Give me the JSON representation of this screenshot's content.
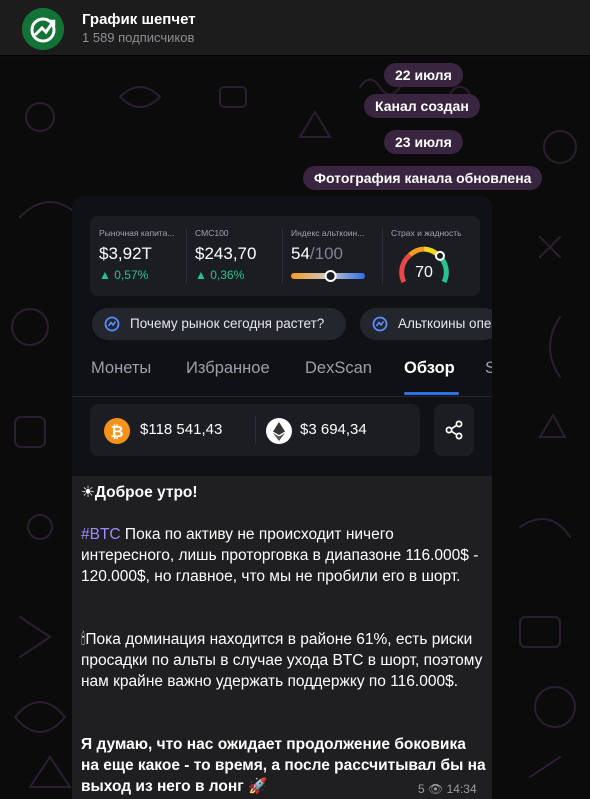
{
  "header": {
    "title": "График шепчет",
    "subscribers": "1 589 подписчиков"
  },
  "service_messages": [
    "22 июля",
    "Канал создан",
    "23 июля",
    "Фотография канала обновлена"
  ],
  "photo": {
    "stats": [
      {
        "label": "Рыночная капита...",
        "value": "$3,92T",
        "change": "0,57%"
      },
      {
        "label": "CMC100",
        "value": "$243,70",
        "change": "0,36%"
      },
      {
        "label": "Индекс альткоин...",
        "value": "54",
        "value_suffix": "/100",
        "slider_level": 0.54
      },
      {
        "label": "Страх и жадность",
        "value": "70",
        "gauge_level": 0.7
      }
    ],
    "chips": [
      "Почему рынок сегодня растет?",
      "Альткоины опе"
    ],
    "tabs": [
      {
        "label": "Монеты",
        "active": false
      },
      {
        "label": "Избранное",
        "active": false
      },
      {
        "label": "DexScan",
        "active": false
      },
      {
        "label": "Обзор",
        "active": true
      },
      {
        "label": "S",
        "active": false
      }
    ],
    "prices": [
      {
        "icon": "bitcoin-icon",
        "color": "#f7931a",
        "value": "$118 541,43"
      },
      {
        "icon": "ethereum-icon",
        "color": "#ffffff",
        "value": "$3 694,34"
      }
    ]
  },
  "message": {
    "greeting": "Доброе утро!",
    "p1_tag": "#BTC",
    "p1_text": " Пока по активу не происходит ничего интересного, лишь проторговка в диапазоне 116.000$ - 120.000$, но главное, что мы не пробили его в шорт.",
    "p2_text": "Пока доминация находится в районе 61%, есть риски просадки по альты в случае ухода BTC в шорт, поэтому нам крайне важно удержать поддержку по 116.000$.",
    "p3_text": "Я думаю, что нас ожидает продолжение боковика на еще какое - то время, а после рассчитывал бы на выход из него в лонг",
    "views": "5",
    "time": "14:34"
  },
  "colors": {
    "accent": "#2f6fe8",
    "positive": "#22c58b",
    "hashtag": "#9c8cff",
    "pill_bg": "#3a2540"
  }
}
